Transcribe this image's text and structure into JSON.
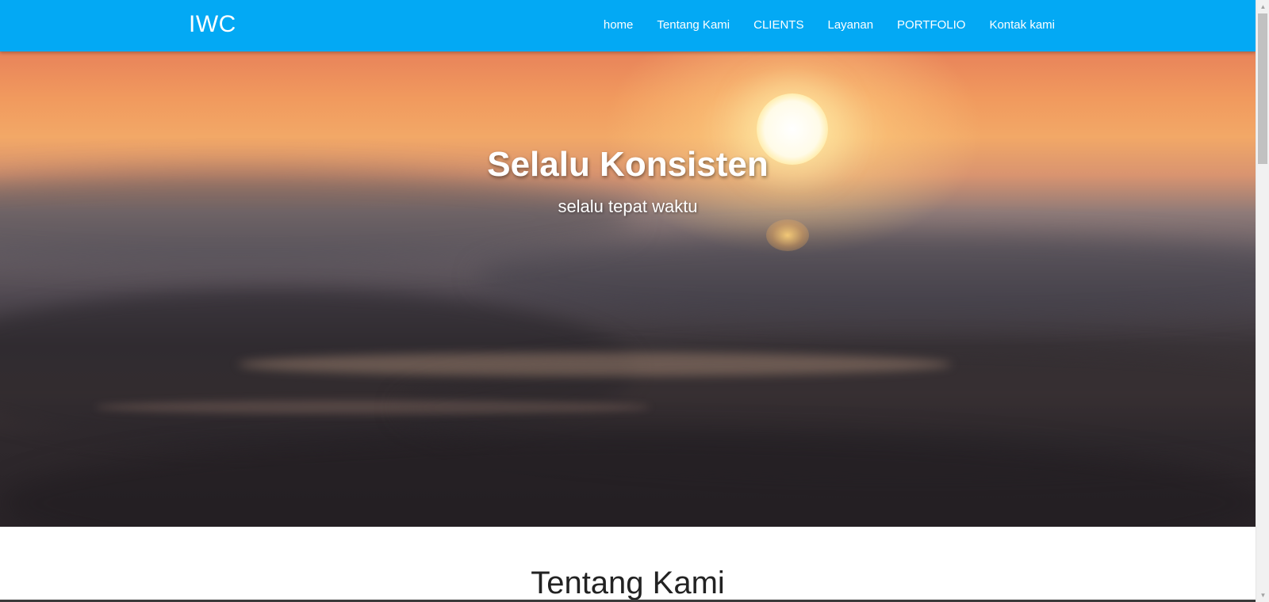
{
  "navbar": {
    "brand": "IWC",
    "background": "#03a9f4",
    "items": [
      {
        "label": "home"
      },
      {
        "label": "Tentang Kami"
      },
      {
        "label": "CLIENTS"
      },
      {
        "label": "Layanan"
      },
      {
        "label": "PORTFOLIO"
      },
      {
        "label": "Kontak kami"
      }
    ]
  },
  "hero": {
    "title": "Selalu Konsisten",
    "subtitle": "selalu tepat waktu",
    "background_image": "sunset-ocean-waves"
  },
  "about": {
    "heading": "Tentang Kami"
  },
  "scrollbar": {
    "up_icon": "triangle-up-icon",
    "down_icon": "triangle-down-icon"
  }
}
